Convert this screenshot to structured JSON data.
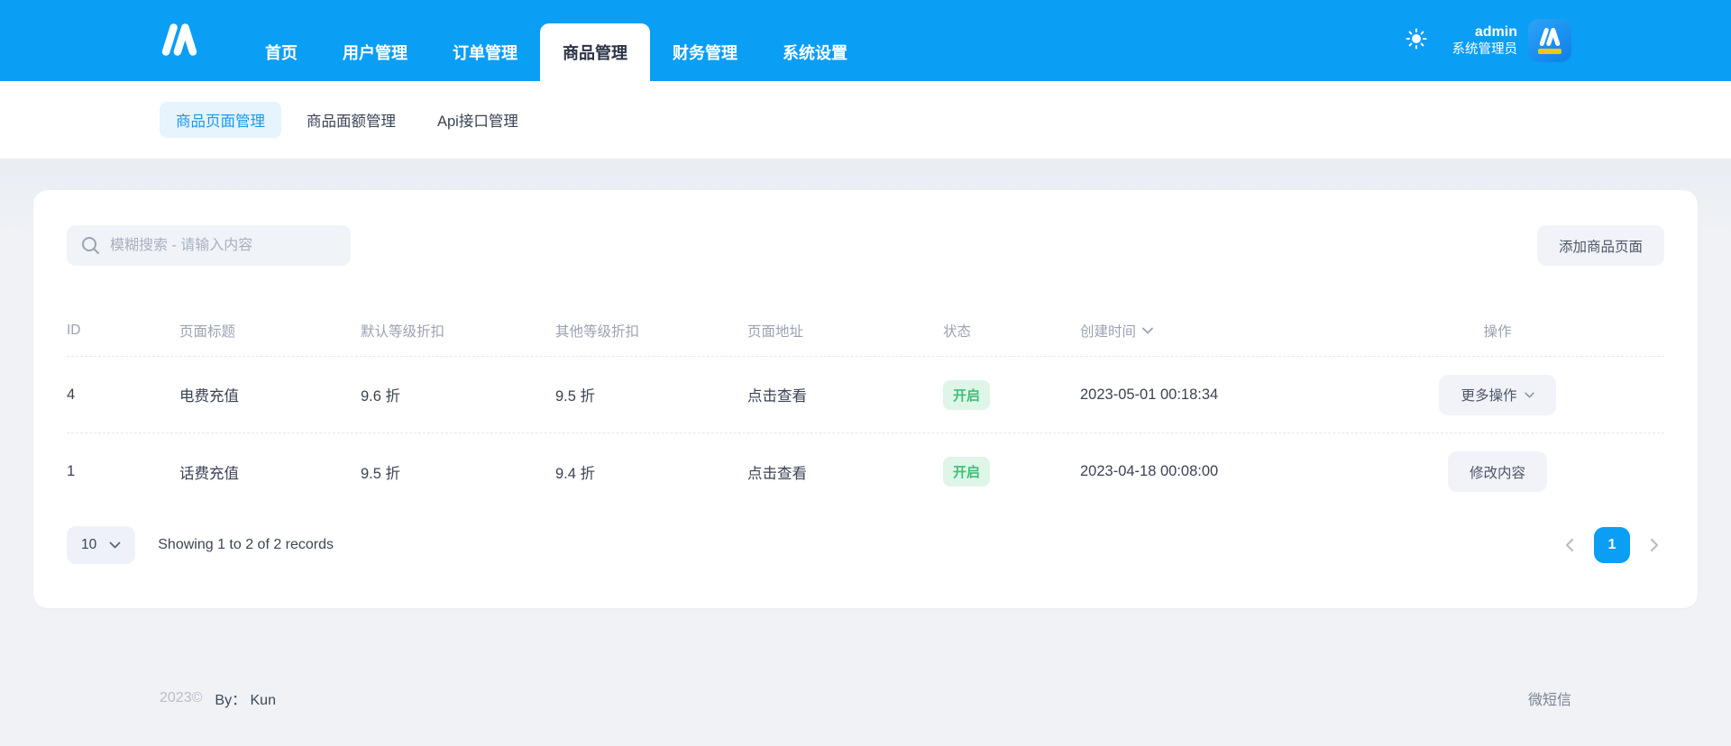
{
  "colors": {
    "accent_blue": "#0a9ef5",
    "active_subtab_bg": "#e7f3fd",
    "active_subtab_text": "#1899ec",
    "badge_green_text": "#3ec077",
    "badge_green_bg": "#def5e8"
  },
  "navbar": {
    "items": [
      {
        "label": "首页",
        "active": false
      },
      {
        "label": "用户管理",
        "active": false
      },
      {
        "label": "订单管理",
        "active": false
      },
      {
        "label": "商品管理",
        "active": true
      },
      {
        "label": "财务管理",
        "active": false
      },
      {
        "label": "系统设置",
        "active": false
      }
    ],
    "user": {
      "name": "admin",
      "role": "系统管理员"
    }
  },
  "subnav": {
    "tabs": [
      {
        "label": "商品页面管理",
        "active": true
      },
      {
        "label": "商品面额管理",
        "active": false
      },
      {
        "label": "Api接口管理",
        "active": false
      }
    ]
  },
  "toolbar": {
    "search_placeholder": "模糊搜索 - 请输入内容",
    "add_button": "添加商品页面"
  },
  "table": {
    "columns": [
      "ID",
      "页面标题",
      "默认等级折扣",
      "其他等级折扣",
      "页面地址",
      "状态",
      "创建时间",
      "操作"
    ],
    "rows": [
      {
        "id": "4",
        "title": "电费充值",
        "default_discount": "9.6 折",
        "other_discount": "9.5 折",
        "page_link": "点击查看",
        "status": "开启",
        "created_at": "2023-05-01 00:18:34",
        "action": "更多操作"
      },
      {
        "id": "1",
        "title": "话费充值",
        "default_discount": "9.5 折",
        "other_discount": "9.4 折",
        "page_link": "点击查看",
        "status": "开启",
        "created_at": "2023-04-18 00:08:00",
        "action": "修改内容"
      }
    ]
  },
  "pagination": {
    "page_size": "10",
    "summary": "Showing 1 to 2 of 2 records",
    "current_page": "1"
  },
  "footer": {
    "copyright": "2023©",
    "by": "By： Kun",
    "right_link": "微短信"
  }
}
